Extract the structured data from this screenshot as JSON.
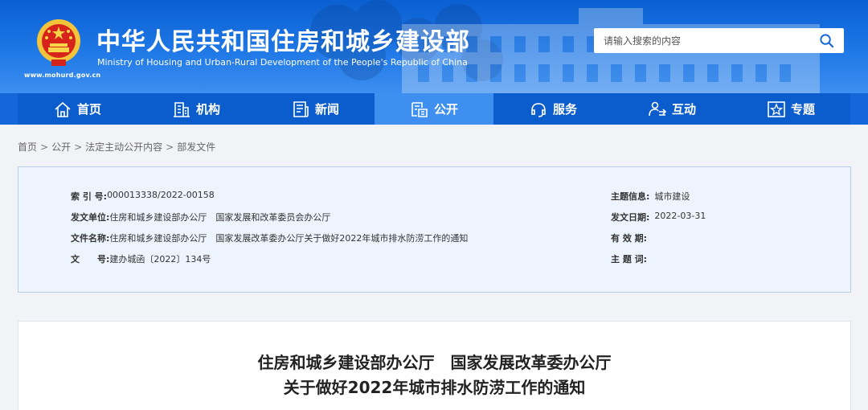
{
  "header": {
    "title": "中华人民共和国住房和城乡建设部",
    "subtitle": "Ministry of Housing and Urban-Rural Development of the People's Republic of China",
    "url": "www.mohurd.gov.cn",
    "search_placeholder": "请输入搜索的内容"
  },
  "nav": {
    "items": [
      {
        "label": "首页",
        "icon": "home-icon"
      },
      {
        "label": "机构",
        "icon": "building-icon"
      },
      {
        "label": "新闻",
        "icon": "news-icon"
      },
      {
        "label": "公开",
        "icon": "disclosure-icon",
        "active": true
      },
      {
        "label": "服务",
        "icon": "service-icon"
      },
      {
        "label": "互动",
        "icon": "interaction-icon"
      },
      {
        "label": "专题",
        "icon": "topic-icon"
      }
    ]
  },
  "breadcrumb": [
    "首页",
    "公开",
    "法定主动公开内容",
    "部发文件"
  ],
  "info": {
    "index_label": "索 引 号:",
    "index_value": "000013338/2022-00158",
    "category_label": "主题信息:",
    "category_value": "城市建设",
    "issuer_label": "发文单位:",
    "issuer_value": "住房和城乡建设部办公厅　国家发展和改革委员会办公厅",
    "date_label": "发文日期:",
    "date_value": "2022-03-31",
    "filename_label": "文件名称:",
    "filename_value": "住房和城乡建设部办公厅　国家发展改革委办公厅关于做好2022年城市排水防涝工作的通知",
    "validity_label": "有 效 期:",
    "docno_label": "文　　号:",
    "docno_value": "建办城函〔2022〕134号",
    "keywords_label": "主 题 词:"
  },
  "article": {
    "title_line1": "住房和城乡建设部办公厅　国家发展改革委办公厅",
    "title_line2": "关于做好2022年城市排水防涝工作的通知"
  },
  "colors": {
    "banner": "#1f78e6",
    "nav": "#0b5ccc",
    "nav_active": "#3e8ff0",
    "info_bg": "#eef4fd"
  }
}
